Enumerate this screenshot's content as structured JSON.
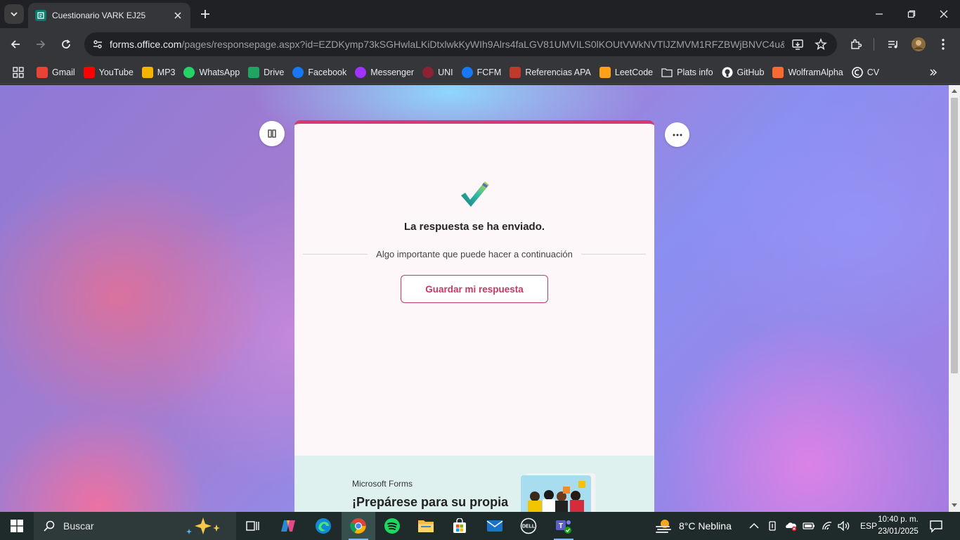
{
  "browser": {
    "tab_title": "Cuestionario VARK EJ25",
    "url_host": "forms.office.com",
    "url_path": "/pages/responsepage.aspx?id=EZDKymp73kSGHwlaLKiDtxlwkKyWIh9Alrs4faLGV81UMVILS0lKOUtVWkNVTlJZMVM1RFZBWjBNVC4u&rou..."
  },
  "bookmarks": [
    {
      "label": "Gmail",
      "icon": "gmail-icon",
      "color": "#ea4335"
    },
    {
      "label": "YouTube",
      "icon": "youtube-icon",
      "color": "#ff0000"
    },
    {
      "label": "MP3",
      "icon": "mp3-icon",
      "color": "#f4b400"
    },
    {
      "label": "WhatsApp",
      "icon": "whatsapp-icon",
      "color": "#25d366"
    },
    {
      "label": "Drive",
      "icon": "drive-icon",
      "color": "#1fa463"
    },
    {
      "label": "Facebook",
      "icon": "facebook-icon",
      "color": "#1877f2"
    },
    {
      "label": "Messenger",
      "icon": "messenger-icon",
      "color": "#a033ff"
    },
    {
      "label": "UNI",
      "icon": "uni-icon",
      "color": "#8b2332"
    },
    {
      "label": "FCFM",
      "icon": "facebook-icon",
      "color": "#1877f2"
    },
    {
      "label": "Referencias APA",
      "icon": "apa-icon",
      "color": "#c0392b"
    },
    {
      "label": "LeetCode",
      "icon": "leetcode-icon",
      "color": "#ffa116"
    },
    {
      "label": "Plats info",
      "icon": "folder-icon",
      "color": "#35363a"
    },
    {
      "label": "GitHub",
      "icon": "github-icon",
      "color": "#ffffff"
    },
    {
      "label": "WolframAlpha",
      "icon": "wolfram-icon",
      "color": "#f96932"
    },
    {
      "label": "CV",
      "icon": "cv-icon",
      "color": "#ffffff"
    }
  ],
  "form": {
    "submitted_message": "La respuesta se ha enviado.",
    "divider_text": "Algo importante que puede hacer a continuación",
    "save_button": "Guardar mi respuesta",
    "accent_color": "#d53b6e"
  },
  "promo": {
    "brand": "Microsoft Forms",
    "title": "¡Prepárese para su propia"
  },
  "taskbar": {
    "search_placeholder": "Buscar",
    "weather": "8°C  Neblina",
    "language": "ESP",
    "time": "10:40 p. m.",
    "date": "23/01/2025"
  }
}
